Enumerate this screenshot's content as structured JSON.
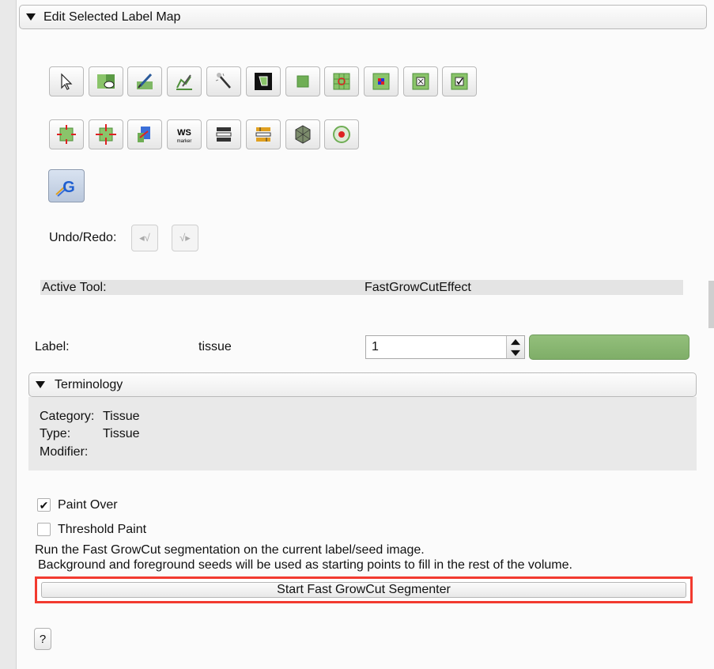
{
  "section": {
    "title": "Edit Selected Label Map"
  },
  "toolbar_row1": [
    "pointer-icon",
    "change-label-icon",
    "paint-icon",
    "draw-icon",
    "wand-icon",
    "level-tracing-icon",
    "rectangle-icon",
    "grid-target-icon",
    "grid-color-icon",
    "grid-remove-icon",
    "grid-check-icon"
  ],
  "toolbar_row2": [
    "erode-icon",
    "dilate-icon",
    "island-icon",
    "ws-marker-icon",
    "threshold-icon",
    "change-island-icon",
    "make-model-icon",
    "growcut-target-icon"
  ],
  "ws_icon_text": {
    "top": "WS",
    "bottom": "marker"
  },
  "growcut_icon_letter": "G",
  "undo": {
    "label": "Undo/Redo:",
    "undo_glyph": "◂√",
    "redo_glyph": "√▸"
  },
  "active_tool": {
    "label": "Active Tool:",
    "value": "FastGrowCutEffect"
  },
  "label_row": {
    "label": "Label:",
    "name": "tissue",
    "value": "1",
    "color": "#86b46f"
  },
  "terminology": {
    "title": "Terminology",
    "category_label": "Category:",
    "category_value": "Tissue",
    "type_label": "Type:",
    "type_value": "Tissue",
    "modifier_label": "Modifier:"
  },
  "options": {
    "paint_over": {
      "label": "Paint Over",
      "checked": true
    },
    "threshold_paint": {
      "label": "Threshold Paint",
      "checked": false
    }
  },
  "description": {
    "line1": "Run the Fast GrowCut segmentation on the current label/seed image.",
    "line2": "Background and foreground seeds will be used as starting points to fill in the rest of the volume."
  },
  "start_button": "Start Fast GrowCut Segmenter",
  "help_button": "?",
  "check_glyph": "✔"
}
